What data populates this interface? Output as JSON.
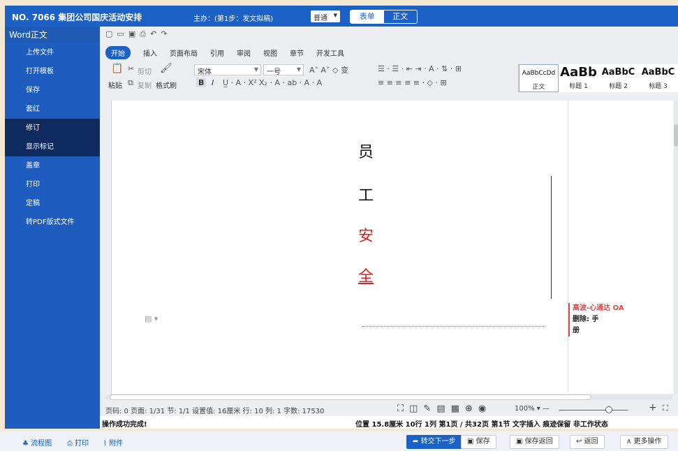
{
  "topbar": {
    "title": "NO. 7066 集团公司国庆活动安排",
    "host": "主办：(第1步：发文拟稿)",
    "select_value": "普通",
    "toggle_form": "表单",
    "toggle_body": "正文"
  },
  "sidebar": {
    "head": "Word正文",
    "items": [
      {
        "label": "上传文件"
      },
      {
        "label": "打开模板"
      },
      {
        "label": "保存"
      },
      {
        "label": "套红"
      },
      {
        "label": "修订"
      },
      {
        "label": "显示标记"
      },
      {
        "label": "盖章"
      },
      {
        "label": "打印"
      },
      {
        "label": "定稿"
      },
      {
        "label": "转PDF版式文件"
      }
    ]
  },
  "ribbon": {
    "tabs": [
      "开始",
      "插入",
      "页面布局",
      "引用",
      "审阅",
      "视图",
      "章节",
      "开发工具"
    ],
    "paste": "粘贴",
    "cut": "剪切",
    "copy": "复制",
    "format_painter": "格式刷",
    "font_name": "宋体",
    "font_size": "一号",
    "styles": [
      {
        "preview": "AaBbCcDd",
        "label": "正文"
      },
      {
        "preview": "AaBb",
        "label": "标题 1"
      },
      {
        "preview": "AaBbC",
        "label": "标题 2"
      },
      {
        "preview": "AaBbC",
        "label": "标题 3"
      }
    ]
  },
  "document": {
    "chars": [
      {
        "text": "员",
        "color": "black"
      },
      {
        "text": "工",
        "color": "black"
      },
      {
        "text": "安",
        "color": "red"
      },
      {
        "text": "全",
        "color": "red"
      }
    ],
    "comment": {
      "author": "高波-心通达 OA",
      "text1": "删除: 手",
      "text2": "册"
    }
  },
  "status": {
    "left": "页码: 0  页面: 1/31  节: 1/1  设置值: 16厘米  行: 10  列: 1  字数: 17530",
    "zoom": "100%",
    "info_ok": "操作成功完成!",
    "info_pos": "位置 15.8厘米  10行 1列   第1页 / 共32页   第1节  文字插入  痕迹保留  非工作状态"
  },
  "bottom": {
    "flow": "流程图",
    "print": "打印",
    "attach": "附件",
    "submit_next": "转交下一步",
    "save": "保存",
    "save_return": "保存返回",
    "return": "返回",
    "more": "更多操作"
  }
}
